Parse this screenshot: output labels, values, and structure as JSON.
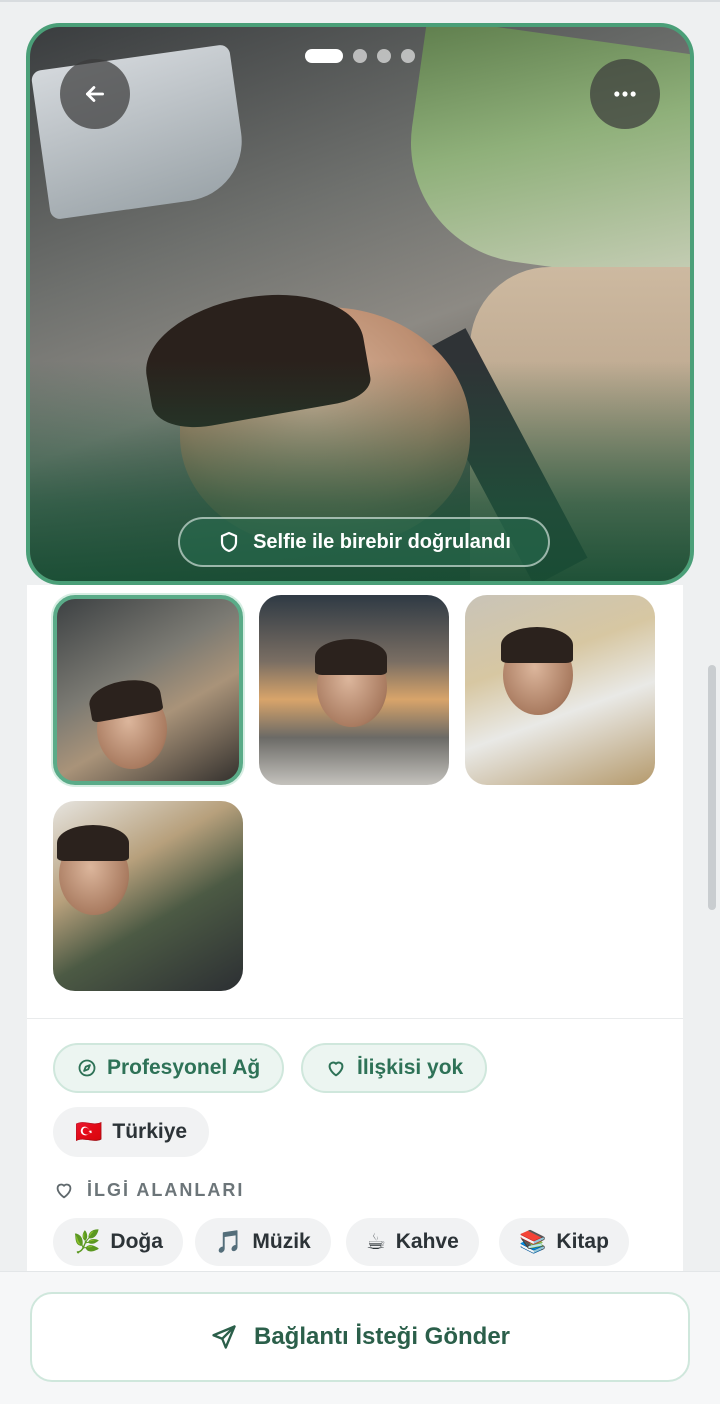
{
  "gallery": {
    "active_index": 0,
    "count": 4,
    "verified_label": "Selfie ile birebir doğrulandı",
    "thumbnails": [
      {
        "name": "car-selfie"
      },
      {
        "name": "beach-sunset"
      },
      {
        "name": "beach-cafe"
      },
      {
        "name": "laptop-home"
      }
    ]
  },
  "tags": {
    "goal": "Profesyonel Ağ",
    "relationship": "İlişkisi yok",
    "country_flag": "🇹🇷",
    "country": "Türkiye"
  },
  "interests": {
    "title": "İLGİ ALANLARI",
    "items": [
      {
        "emoji": "🌿",
        "label": "Doğa"
      },
      {
        "emoji": "🎵",
        "label": "Müzik"
      },
      {
        "emoji": "☕",
        "label": "Kahve"
      },
      {
        "emoji": "📚",
        "label": "Kitap"
      }
    ]
  },
  "cta": {
    "label": "Bağlantı İsteği Gönder"
  },
  "colors": {
    "accent": "#4a9f78",
    "accent_dark": "#2e7257",
    "chip_bg": "#ecf5f1"
  }
}
